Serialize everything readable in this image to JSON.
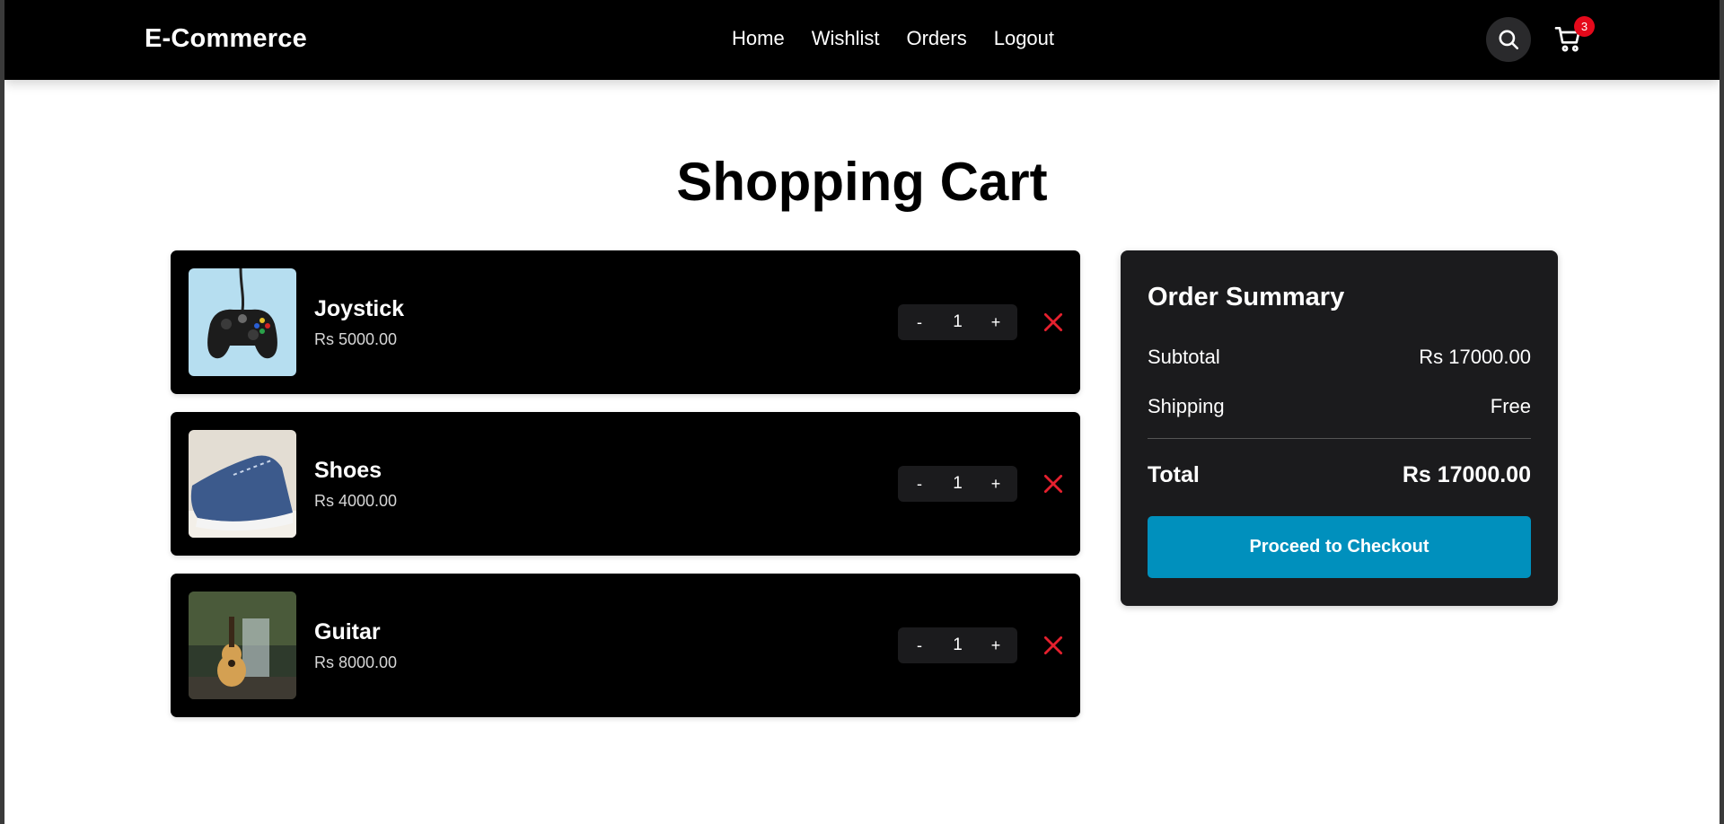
{
  "navbar": {
    "brand": "E-Commerce",
    "links": [
      "Home",
      "Wishlist",
      "Orders",
      "Logout"
    ],
    "cart_count": "3",
    "icons": {
      "search": "search-icon",
      "cart": "cart-icon"
    }
  },
  "page": {
    "title": "Shopping Cart"
  },
  "cart": {
    "items": [
      {
        "name": "Joystick",
        "price": "Rs 5000.00",
        "quantity": "1",
        "minus": "-",
        "plus": "+",
        "image": "game-controller"
      },
      {
        "name": "Shoes",
        "price": "Rs 4000.00",
        "quantity": "1",
        "minus": "-",
        "plus": "+",
        "image": "blue-sneaker"
      },
      {
        "name": "Guitar",
        "price": "Rs 8000.00",
        "quantity": "1",
        "minus": "-",
        "plus": "+",
        "image": "acoustic-guitar"
      }
    ]
  },
  "summary": {
    "title": "Order Summary",
    "subtotal_label": "Subtotal",
    "subtotal_value": "Rs 17000.00",
    "shipping_label": "Shipping",
    "shipping_value": "Free",
    "total_label": "Total",
    "total_value": "Rs 17000.00",
    "checkout_label": "Proceed to Checkout"
  },
  "colors": {
    "navbar_bg": "#000000",
    "badge": "#e5091b",
    "remove": "#e5202e",
    "checkout": "#0090bd",
    "summary_bg": "#1b1b1d"
  }
}
